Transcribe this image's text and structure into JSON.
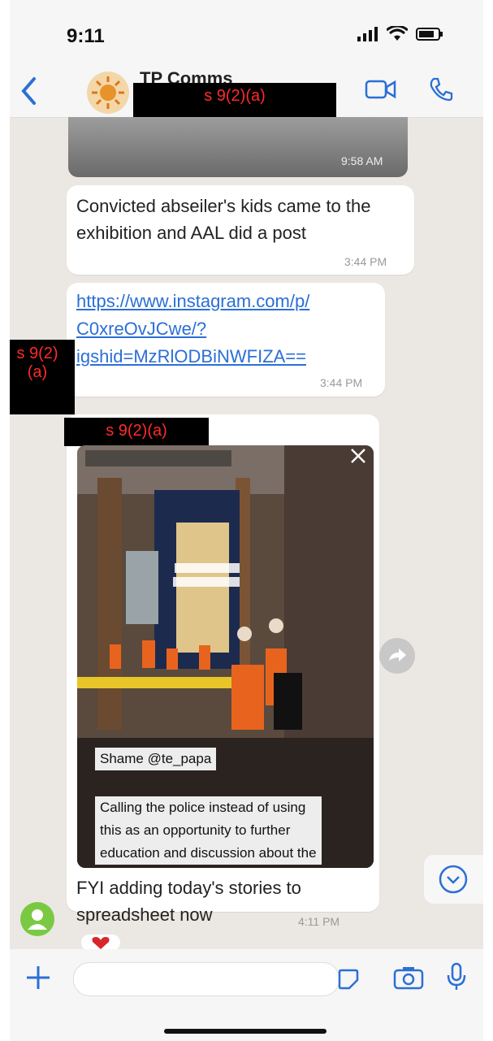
{
  "status_bar": {
    "time": "9:11"
  },
  "header": {
    "chat_name": "TP Comms",
    "redaction": "s 9(2)(a)"
  },
  "messages": {
    "image_timestamp": "9:58 AM",
    "msg1_text": "Convicted abseiler's kids came to the exhibition and AAL did a post",
    "msg1_time": "3:44 PM",
    "link_lines": [
      "https://www.instagram.com/p/",
      "C0xreOvJCwe/?",
      "igshid=MzRlODBiNWFIZA=="
    ],
    "link_time": "3:44 PM",
    "left_redaction": "s 9(2)\n(a)",
    "sender_redaction": "s 9(2)(a)",
    "video_overlay": {
      "tag": "Shame @te_papa",
      "caption_lines": [
        "Calling the police instead of using",
        "this as an opportunity to further",
        "education and discussion about the"
      ]
    },
    "msg2_text": "FYI adding today's stories to spreadsheet now",
    "msg2_time": "4:11 PM"
  },
  "colors": {
    "accent": "#2b6fd6",
    "redact_text": "#ff2a2a",
    "bg": "#ebe8e3"
  }
}
